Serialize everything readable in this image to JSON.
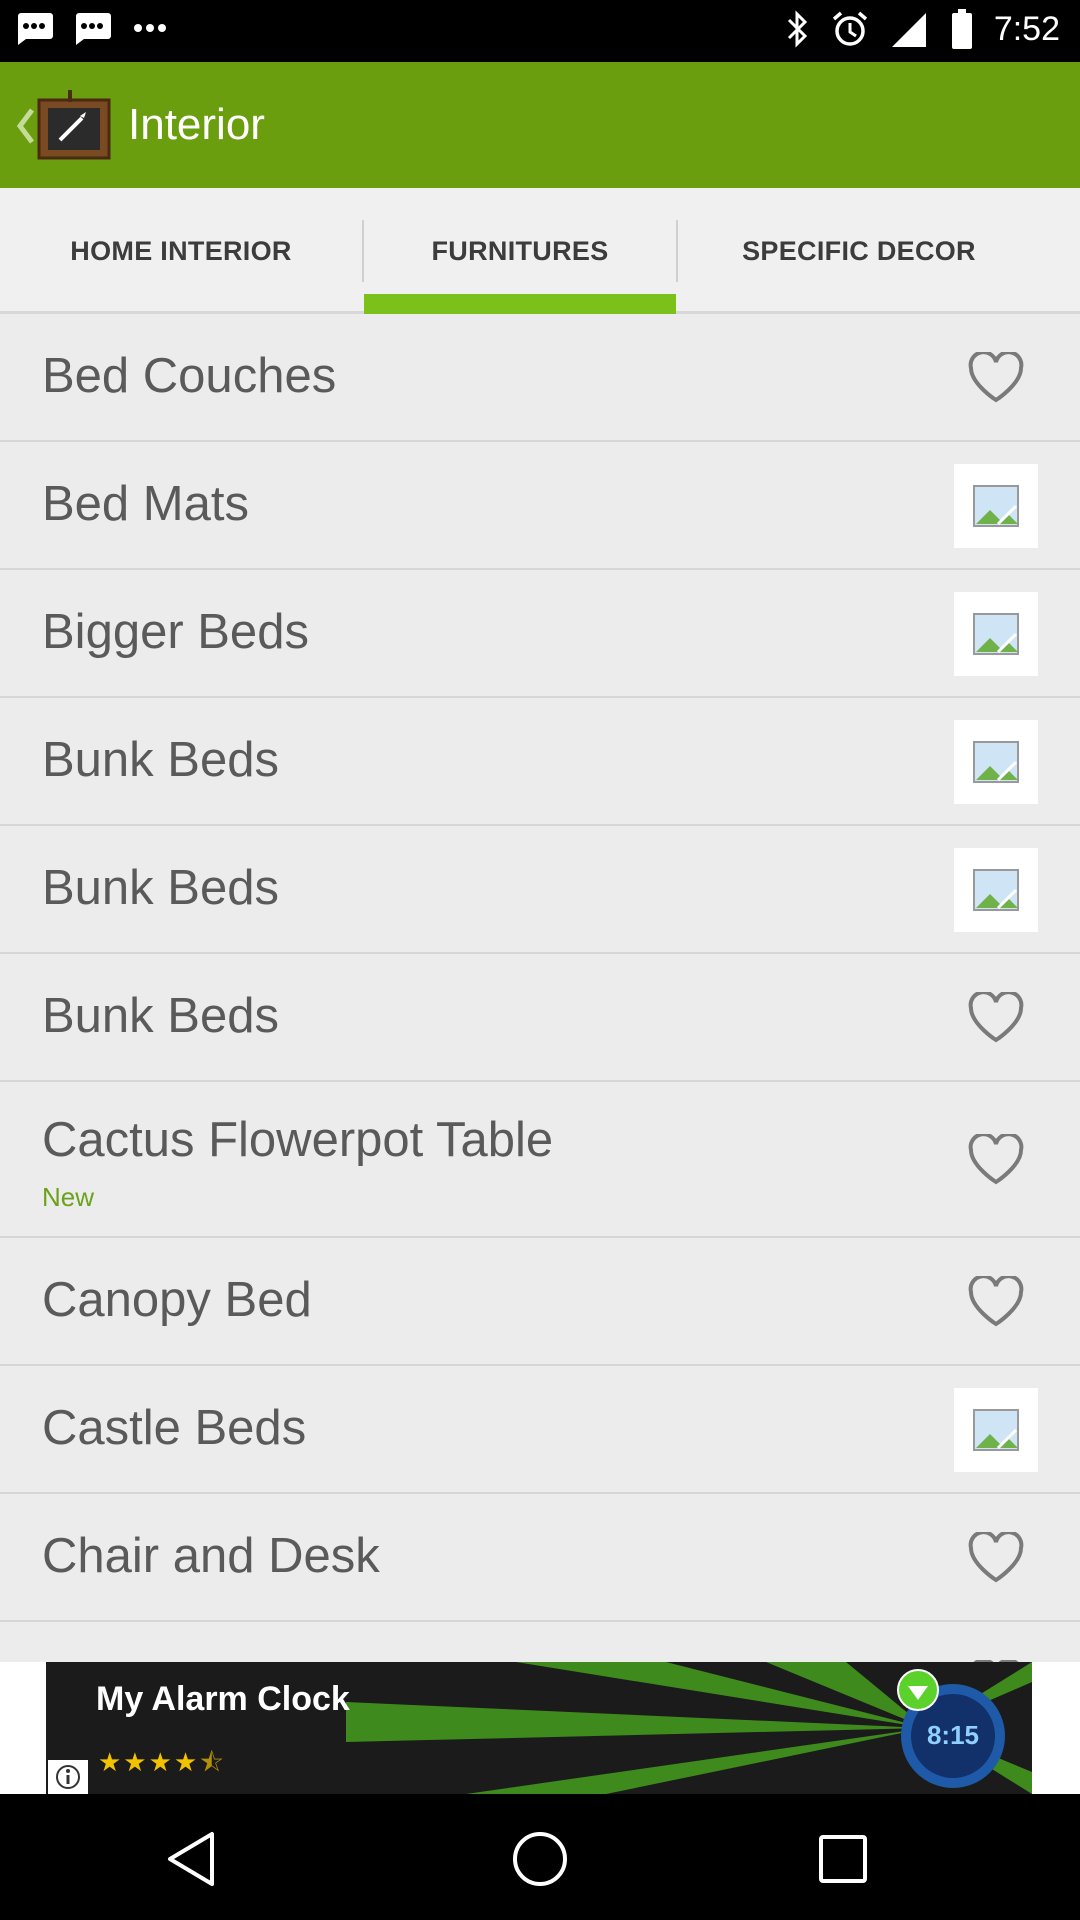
{
  "status_bar": {
    "time": "7:52",
    "icons": [
      "message-icon",
      "message-icon",
      "more-dots-icon",
      "bluetooth-icon",
      "alarm-icon",
      "signal-icon",
      "battery-icon"
    ]
  },
  "app_bar": {
    "title": "Interior",
    "back_icon": "chevron-left-icon",
    "logo_icon": "app-logo-icon"
  },
  "tabs": [
    {
      "label": "HOME INTERIOR",
      "active": false
    },
    {
      "label": "FURNITURES",
      "active": true
    },
    {
      "label": "SPECIFIC DECOR",
      "active": false
    }
  ],
  "list": {
    "items": [
      {
        "title": "Bed Couches",
        "subtitle": "",
        "icon": "heart-icon"
      },
      {
        "title": "Bed Mats",
        "subtitle": "",
        "icon": "image-thumbnail-icon"
      },
      {
        "title": "Bigger Beds",
        "subtitle": "",
        "icon": "image-thumbnail-icon"
      },
      {
        "title": "Bunk Beds",
        "subtitle": "",
        "icon": "image-thumbnail-icon"
      },
      {
        "title": "Bunk Beds",
        "subtitle": "",
        "icon": "image-thumbnail-icon"
      },
      {
        "title": "Bunk Beds",
        "subtitle": "",
        "icon": "heart-icon"
      },
      {
        "title": "Cactus Flowerpot Table",
        "subtitle": "New",
        "icon": "heart-icon"
      },
      {
        "title": "Canopy Bed",
        "subtitle": "",
        "icon": "heart-icon"
      },
      {
        "title": "Castle Beds",
        "subtitle": "",
        "icon": "image-thumbnail-icon"
      },
      {
        "title": "Chair and Desk",
        "subtitle": "",
        "icon": "heart-icon"
      }
    ]
  },
  "ad": {
    "title": "My Alarm Clock",
    "rating": 4.5,
    "clock_text": "8:15",
    "icons": [
      "info-icon",
      "download-arrow-icon",
      "clock-icon"
    ]
  },
  "nav_bar": {
    "buttons": [
      "back-triangle-icon",
      "home-circle-icon",
      "recents-square-icon"
    ]
  },
  "colors": {
    "app_bar": "#6a9e0f",
    "tab_indicator": "#7cc01c",
    "new_label": "#6aa21b",
    "list_bg": "#ececec"
  }
}
